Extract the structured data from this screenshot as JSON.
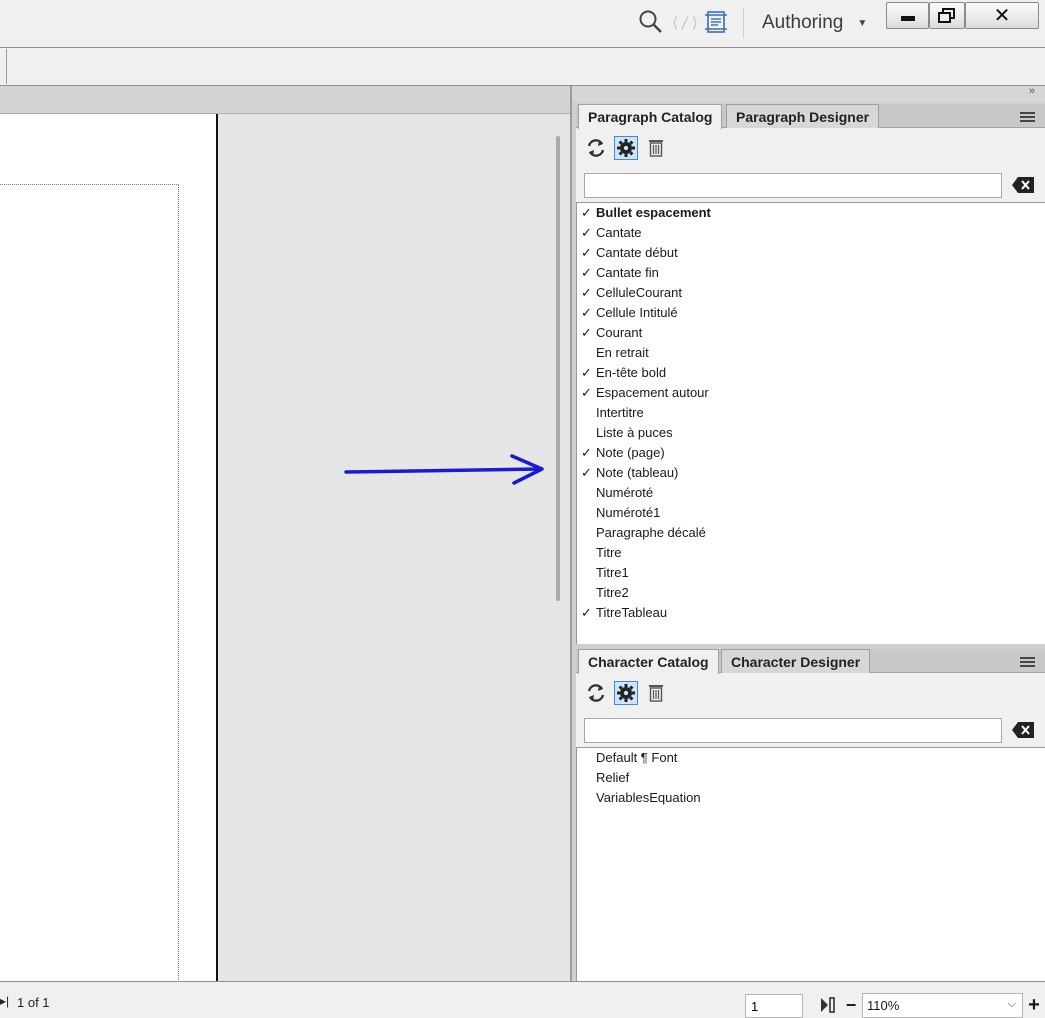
{
  "titlebar": {
    "workspace_label": "Authoring",
    "code_icon_glyph": "⟨/⟩",
    "close_glyph": "✕"
  },
  "paragraph_pod": {
    "tabs": [
      {
        "label": "Paragraph Catalog",
        "active": true
      },
      {
        "label": "Paragraph Designer",
        "active": false
      }
    ],
    "search": {
      "value": "",
      "placeholder": ""
    },
    "items": [
      {
        "label": "Bullet espacement",
        "check": "✓",
        "bold": true
      },
      {
        "label": "Cantate",
        "check": "✓"
      },
      {
        "label": "Cantate début",
        "check": "✓"
      },
      {
        "label": "Cantate fin",
        "check": "✓"
      },
      {
        "label": "CelluleCourant",
        "check": "✓"
      },
      {
        "label": "Cellule Intitulé",
        "check": "✓"
      },
      {
        "label": "Courant",
        "check": "✓"
      },
      {
        "label": "En retrait",
        "check": ""
      },
      {
        "label": "En-tête bold",
        "check": "✓"
      },
      {
        "label": "Espacement autour",
        "check": "✓"
      },
      {
        "label": "Intertitre",
        "check": ""
      },
      {
        "label": "Liste à puces",
        "check": ""
      },
      {
        "label": "Note (page)",
        "check": "✓"
      },
      {
        "label": "Note (tableau)",
        "check": "✓"
      },
      {
        "label": "Numéroté",
        "check": ""
      },
      {
        "label": "Numéroté1",
        "check": ""
      },
      {
        "label": "Paragraphe décalé",
        "check": ""
      },
      {
        "label": "Titre",
        "check": ""
      },
      {
        "label": "Titre1",
        "check": ""
      },
      {
        "label": "Titre2",
        "check": ""
      },
      {
        "label": "TitreTableau",
        "check": "✓"
      }
    ]
  },
  "character_pod": {
    "tabs": [
      {
        "label": "Character Catalog",
        "active": true
      },
      {
        "label": "Character Designer",
        "active": false
      }
    ],
    "search": {
      "value": "",
      "placeholder": ""
    },
    "items": [
      {
        "label": "Default ¶ Font",
        "check": ""
      },
      {
        "label": "Relief",
        "check": ""
      },
      {
        "label": "VariablesEquation",
        "check": ""
      }
    ]
  },
  "statusbar": {
    "first_page_glyph": "▸|",
    "page_count": "1 of 1",
    "page_input": "1",
    "zoom": "110%",
    "zoom_out_glyph": "−",
    "zoom_in_glyph": "+"
  },
  "colors": {
    "annotation_arrow": "#1a1ad6",
    "active_tool": "#3d8ad8"
  }
}
